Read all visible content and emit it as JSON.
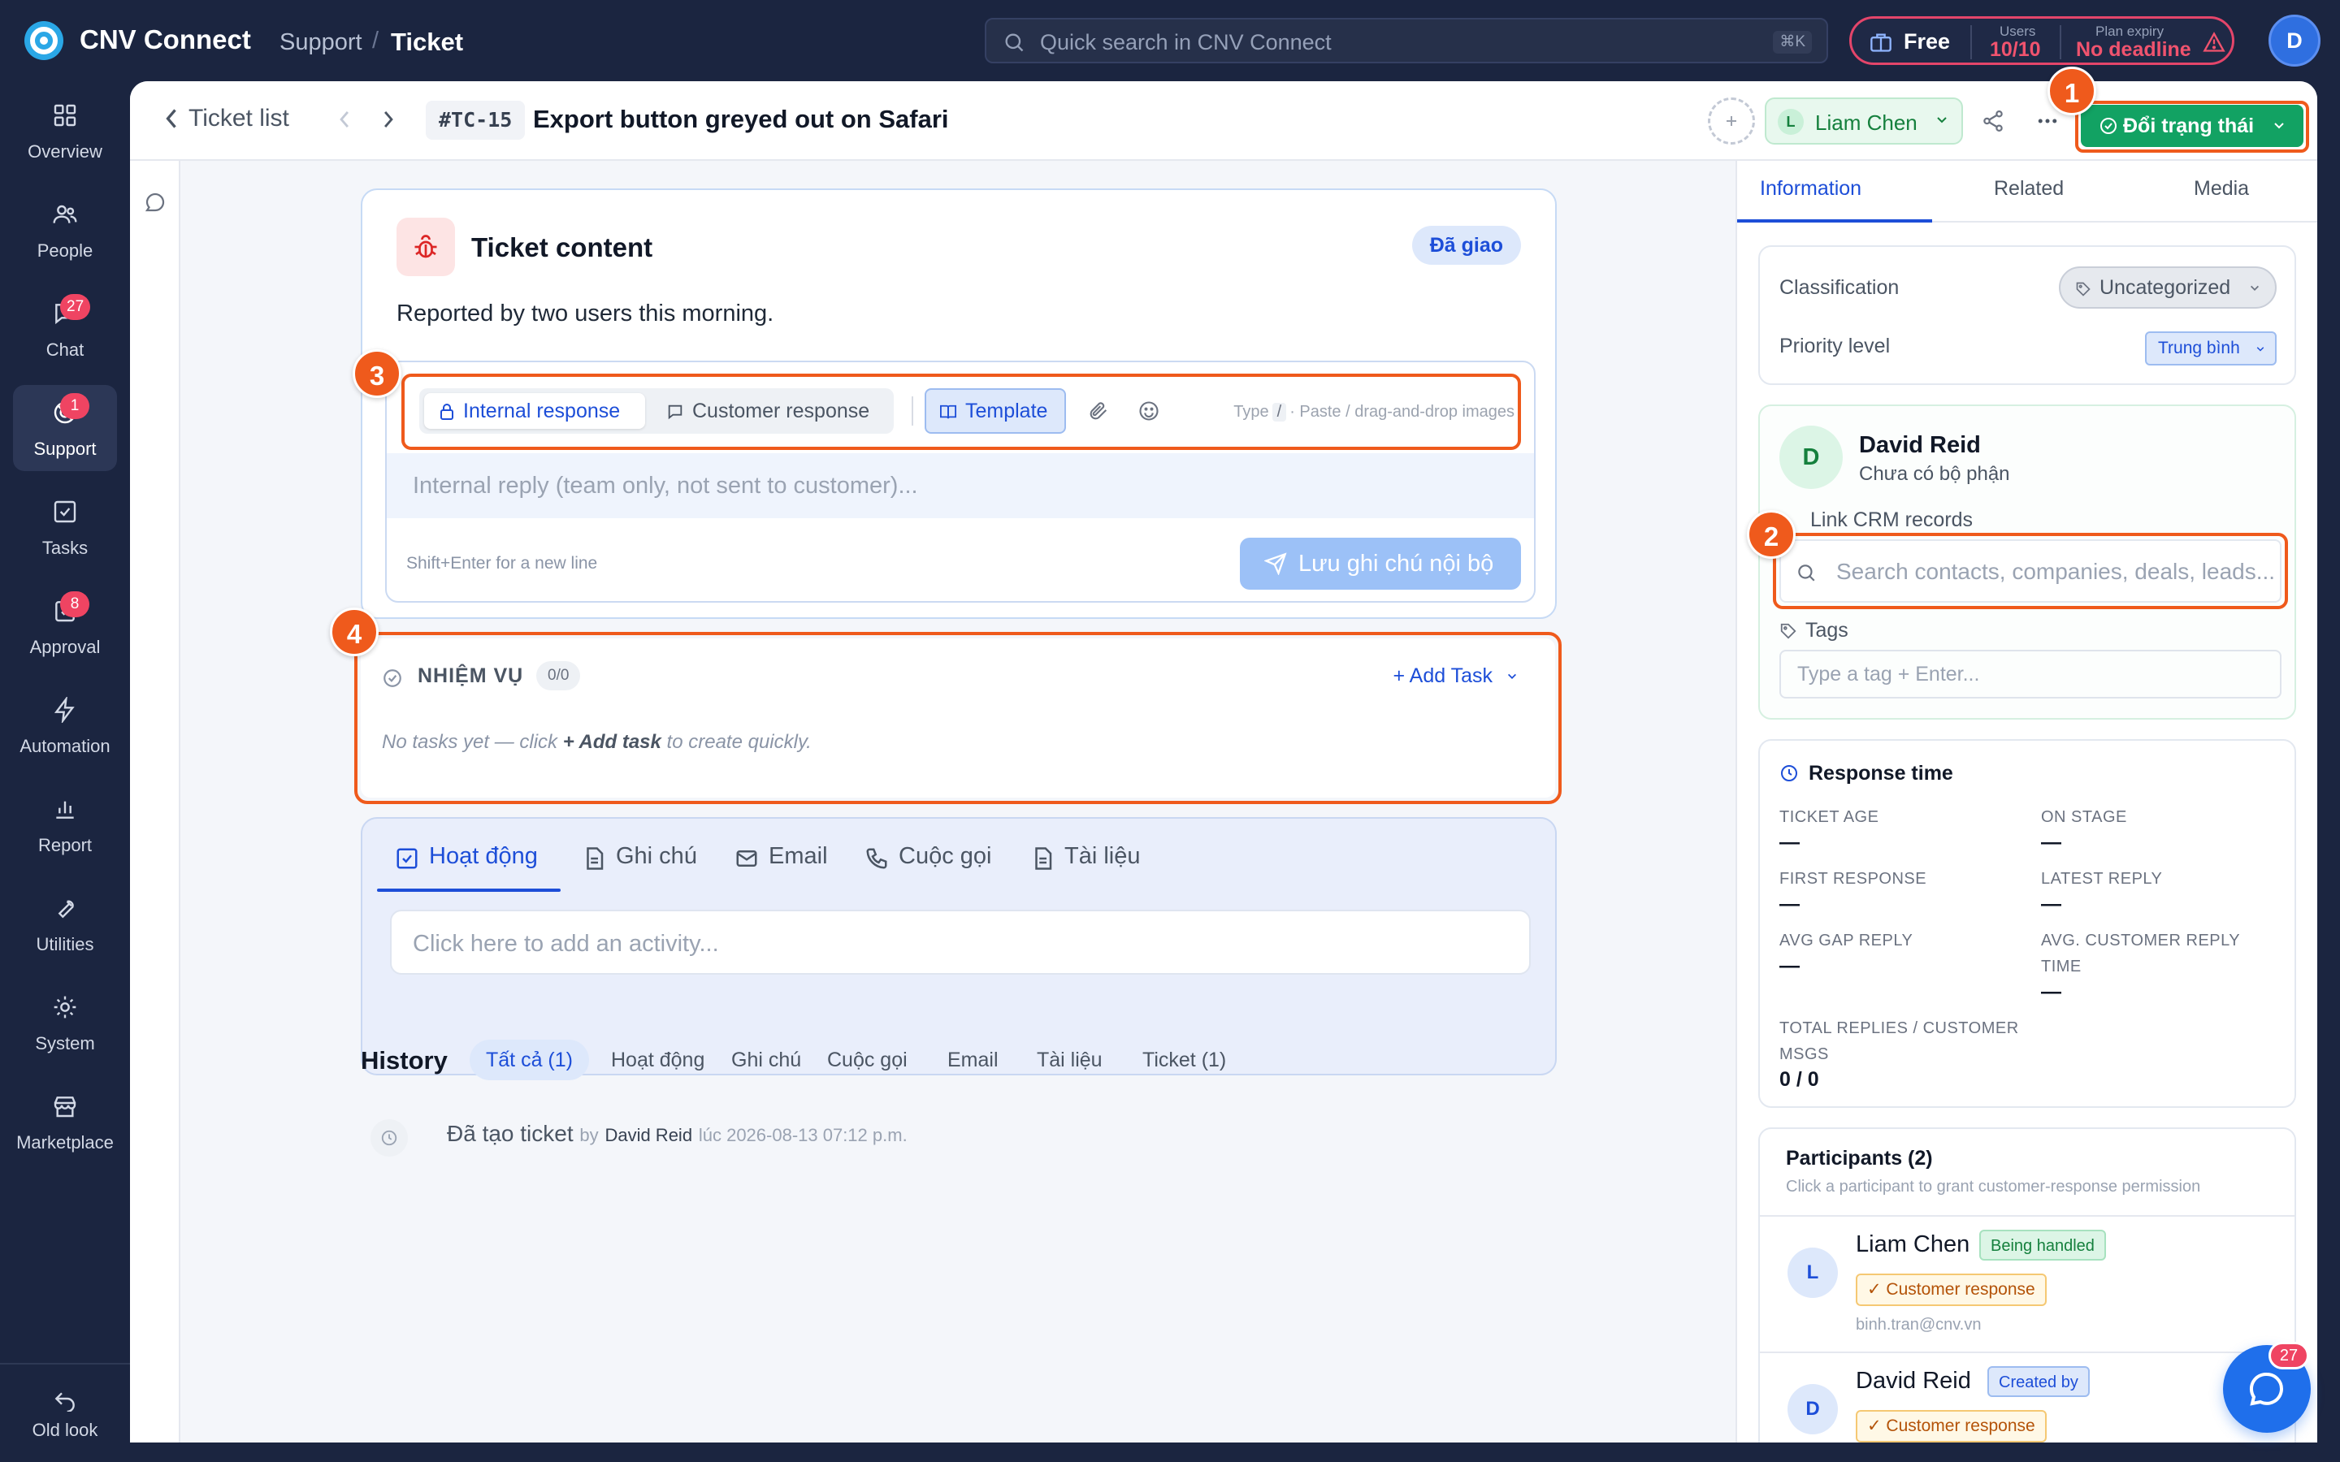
{
  "app": {
    "name": "CNV Connect"
  },
  "breadcrumb": {
    "section": "Support",
    "separator": "/",
    "page": "Ticket"
  },
  "search": {
    "placeholder": "Quick search in CNV Connect",
    "shortcut": "⌘K"
  },
  "plan": {
    "name": "Free",
    "users_label": "Users",
    "users_value": "10/10",
    "expiry_label": "Plan expiry",
    "expiry_value": "No deadline"
  },
  "user": {
    "initial": "D"
  },
  "nav": {
    "items": [
      {
        "label": "Overview",
        "icon": "grid-icon"
      },
      {
        "label": "People",
        "icon": "people-icon"
      },
      {
        "label": "Chat",
        "icon": "chat-icon",
        "badge": "27"
      },
      {
        "label": "Support",
        "icon": "support-icon",
        "badge": "1",
        "active": true
      },
      {
        "label": "Tasks",
        "icon": "task-icon"
      },
      {
        "label": "Approval",
        "icon": "approval-icon",
        "badge": "8"
      },
      {
        "label": "Automation",
        "icon": "bolt-icon"
      },
      {
        "label": "Report",
        "icon": "chart-icon"
      },
      {
        "label": "Utilities",
        "icon": "wrench-icon"
      },
      {
        "label": "System",
        "icon": "gear-icon"
      },
      {
        "label": "Marketplace",
        "icon": "store-icon"
      }
    ],
    "old_look": "Old look"
  },
  "header": {
    "back_label": "Ticket list",
    "ticket_id": "#TC-15",
    "title": "Export button greyed out on Safari",
    "assignee_initial": "L",
    "assignee_name": "Liam Chen",
    "status_button": "Đổi trạng thái"
  },
  "markers": [
    "1",
    "2",
    "3",
    "4"
  ],
  "ticket": {
    "section_title": "Ticket content",
    "status": "Đã giao",
    "description": "Reported by two users this morning."
  },
  "reply": {
    "tab_internal": "Internal response",
    "tab_customer": "Customer response",
    "template": "Template",
    "hint_type": "Type",
    "hint_key": "/",
    "hint_rest": "· Paste / drag-and-drop images",
    "placeholder": "Internal reply (team only, not sent to customer)...",
    "newline_hint": "Shift+Enter for a new line",
    "save": "Lưu ghi chú nội bộ"
  },
  "tasks": {
    "title": "NHIỆM VỤ",
    "count": "0/0",
    "add": "Add Task",
    "empty_prefix": "No tasks yet — click ",
    "empty_action": "+ Add task",
    "empty_suffix": " to create quickly."
  },
  "activity": {
    "tabs": [
      "Hoạt động",
      "Ghi chú",
      "Email",
      "Cuộc gọi",
      "Tài liệu"
    ],
    "placeholder": "Click here to add an activity..."
  },
  "history": {
    "title": "History",
    "filters": [
      "Tất cả (1)",
      "Hoạt động",
      "Ghi chú",
      "Cuộc gọi",
      "Email",
      "Tài liệu",
      "Ticket (1)"
    ],
    "entry": {
      "action": "Đã tạo ticket",
      "by": "by",
      "who": "David Reid",
      "time": "lúc 2026-08-13 07:12 p.m."
    }
  },
  "right": {
    "tabs": [
      "Information",
      "Related",
      "Media"
    ],
    "classification_label": "Classification",
    "classification_value": "Uncategorized",
    "priority_label": "Priority level",
    "priority_value": "Trung bình",
    "customer": {
      "initial": "D",
      "name": "David Reid",
      "department": "Chưa có bộ phận",
      "crm_label": "Link CRM records",
      "crm_placeholder": "Search contacts, companies, deals, leads...",
      "tags_label": "Tags",
      "tags_placeholder": "Type a tag + Enter..."
    },
    "response_time": {
      "title": "Response time",
      "metrics": [
        {
          "label": "TICKET AGE",
          "value": "—"
        },
        {
          "label": "ON STAGE",
          "value": "—"
        },
        {
          "label": "FIRST RESPONSE",
          "value": "—"
        },
        {
          "label": "LATEST REPLY",
          "value": "—"
        },
        {
          "label": "AVG GAP REPLY",
          "value": "—"
        },
        {
          "label": "AVG. CUSTOMER REPLY TIME",
          "value": "—"
        },
        {
          "label": "TOTAL REPLIES / CUSTOMER MSGS",
          "value": "0 / 0"
        }
      ]
    },
    "participants": {
      "title": "Participants (2)",
      "subtitle": "Click a participant to grant customer-response permission",
      "list": [
        {
          "initial": "L",
          "name": "Liam Chen",
          "role": "Being handled",
          "permission": "✓ Customer response",
          "email": "binh.tran@cnv.vn"
        },
        {
          "initial": "D",
          "name": "David Reid",
          "role": "Created by",
          "permission": "✓ Customer response"
        }
      ]
    }
  },
  "chat_fab": {
    "badge": "27"
  }
}
